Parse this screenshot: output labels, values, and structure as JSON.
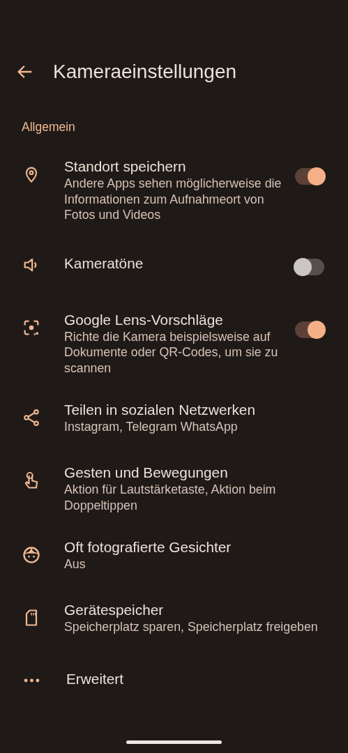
{
  "header": {
    "title": "Kameraeinstellungen"
  },
  "section": {
    "label": "Allgemein"
  },
  "items": [
    {
      "kind": "toggle",
      "title": "Standort speichern",
      "subtitle": "Andere Apps sehen möglicherweise die Informationen zum Aufnahmeort von Fotos und Videos",
      "on": true
    },
    {
      "kind": "toggle",
      "title": "Kameratöne",
      "on": false
    },
    {
      "kind": "toggle",
      "title": "Google Lens-Vorschläge",
      "subtitle": "Richte die Kamera beispielsweise auf Dokumente oder QR-Codes, um sie zu scannen",
      "on": true
    },
    {
      "kind": "link",
      "title": "Teilen in sozialen Netzwerken",
      "subtitle": "Instagram, Telegram WhatsApp"
    },
    {
      "kind": "link",
      "title": "Gesten und Bewegungen",
      "subtitle": "Aktion für Lautstärketaste, Aktion beim Doppeltippen"
    },
    {
      "kind": "link",
      "title": "Oft fotografierte Gesichter",
      "subtitle": "Aus"
    },
    {
      "kind": "link",
      "title": "Gerätespeicher",
      "subtitle": "Speicherplatz sparen, Speicherplatz freigeben"
    },
    {
      "kind": "link",
      "title": "Erweitert"
    }
  ]
}
